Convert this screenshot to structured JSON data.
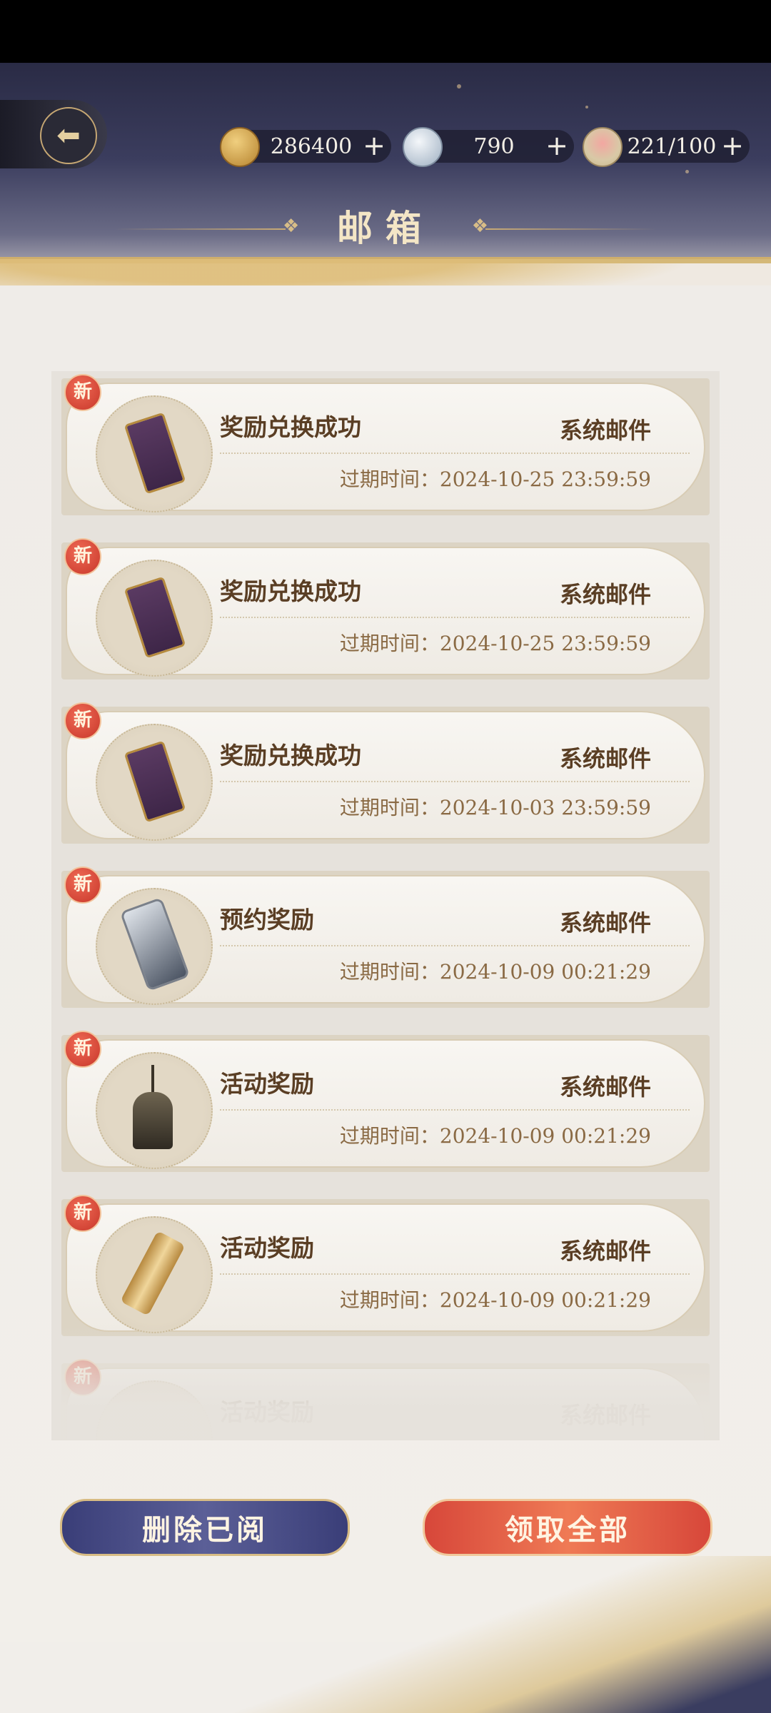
{
  "resources": [
    {
      "name": "coin",
      "value": "286400",
      "plus": "+",
      "color": "#c89a4a"
    },
    {
      "name": "jade",
      "value": "790",
      "plus": "+",
      "color": "#c9d2dc"
    },
    {
      "name": "stamina-bowl",
      "value": "221/100",
      "plus": "+",
      "color": "#e7c7c4"
    }
  ],
  "header": {
    "title": "邮箱",
    "back_icon": "⬅"
  },
  "mails": [
    {
      "badge": "新",
      "title": "奖励兑换成功",
      "sender": "系统邮件",
      "expire": "过期时间：2024-10-25 23:59:59",
      "icon": "token-icon"
    },
    {
      "badge": "新",
      "title": "奖励兑换成功",
      "sender": "系统邮件",
      "expire": "过期时间：2024-10-25 23:59:59",
      "icon": "token-icon"
    },
    {
      "badge": "新",
      "title": "奖励兑换成功",
      "sender": "系统邮件",
      "expire": "过期时间：2024-10-03 23:59:59",
      "icon": "token-icon"
    },
    {
      "badge": "新",
      "title": "预约奖励",
      "sender": "系统邮件",
      "expire": "过期时间：2024-10-09 00:21:29",
      "icon": "mirror-icon"
    },
    {
      "badge": "新",
      "title": "活动奖励",
      "sender": "系统邮件",
      "expire": "过期时间：2024-10-09 00:21:29",
      "icon": "bell-icon"
    },
    {
      "badge": "新",
      "title": "活动奖励",
      "sender": "系统邮件",
      "expire": "过期时间：2024-10-09 00:21:29",
      "icon": "scroll-icon"
    },
    {
      "badge": "新",
      "title": "活动奖励",
      "sender": "系统邮件",
      "expire": "",
      "icon": "dragon-icon"
    }
  ],
  "buttons": {
    "delete_read": "删除已阅",
    "claim_all": "领取全部"
  }
}
